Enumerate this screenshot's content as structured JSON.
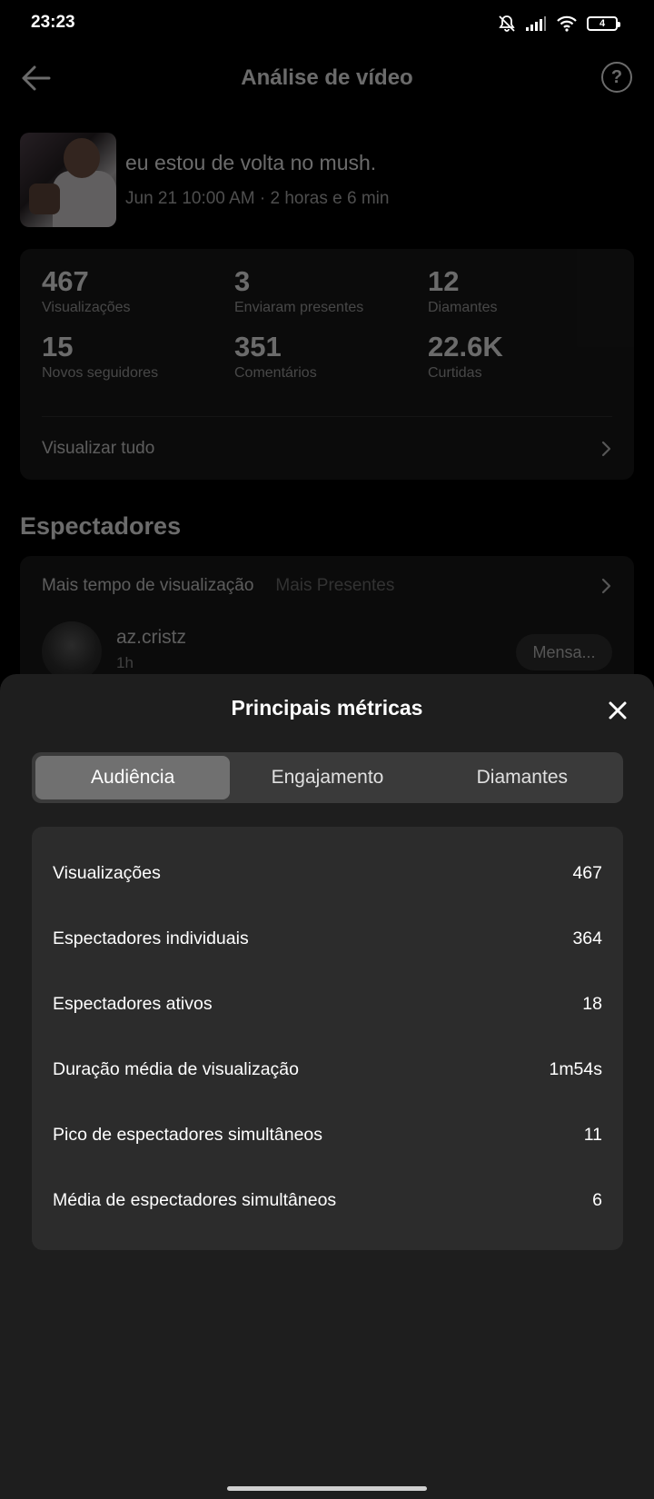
{
  "status_bar": {
    "time": "23:23",
    "battery": "4"
  },
  "header": {
    "title": "Análise de vídeo",
    "help_glyph": "?"
  },
  "video": {
    "title": "eu estou de volta no mush.",
    "meta": "Jun 21 10:00 AM · 2 horas e 6 min"
  },
  "stats": [
    {
      "value": "467",
      "label": "Visualizações"
    },
    {
      "value": "3",
      "label": "Enviaram presentes"
    },
    {
      "value": "12",
      "label": "Diamantes"
    },
    {
      "value": "15",
      "label": "Novos seguidores"
    },
    {
      "value": "351",
      "label": "Comentários"
    },
    {
      "value": "22.6K",
      "label": "Curtidas"
    }
  ],
  "view_all": "Visualizar tudo",
  "viewers": {
    "section_title": "Espectadores",
    "tab_active": "Mais tempo de visualização",
    "tab_other": "Mais Presentes",
    "name": "az.cristz",
    "time": "1h",
    "message_button": "Mensa..."
  },
  "sheet": {
    "title": "Principais métricas",
    "tabs": [
      "Audiência",
      "Engajamento",
      "Diamantes"
    ],
    "active_tab": 0,
    "metrics": [
      {
        "label": "Visualizações",
        "value": "467"
      },
      {
        "label": "Espectadores individuais",
        "value": "364"
      },
      {
        "label": "Espectadores ativos",
        "value": "18"
      },
      {
        "label": "Duração média de visualização",
        "value": "1m54s"
      },
      {
        "label": "Pico de espectadores simultâneos",
        "value": "11"
      },
      {
        "label": "Média de espectadores simultâneos",
        "value": "6"
      }
    ]
  },
  "icons": {
    "back": "arrow-left-icon",
    "help": "question-circle-icon",
    "chevron": "chevron-right-icon",
    "close": "close-icon",
    "mute": "bell-off-icon",
    "signal": "signal-icon",
    "wifi": "wifi-icon",
    "battery": "battery-icon"
  },
  "colors": {
    "background": "#000000",
    "sheet": "#1e1e1e",
    "card": "#2c2c2c",
    "active_tab": "#707070"
  }
}
